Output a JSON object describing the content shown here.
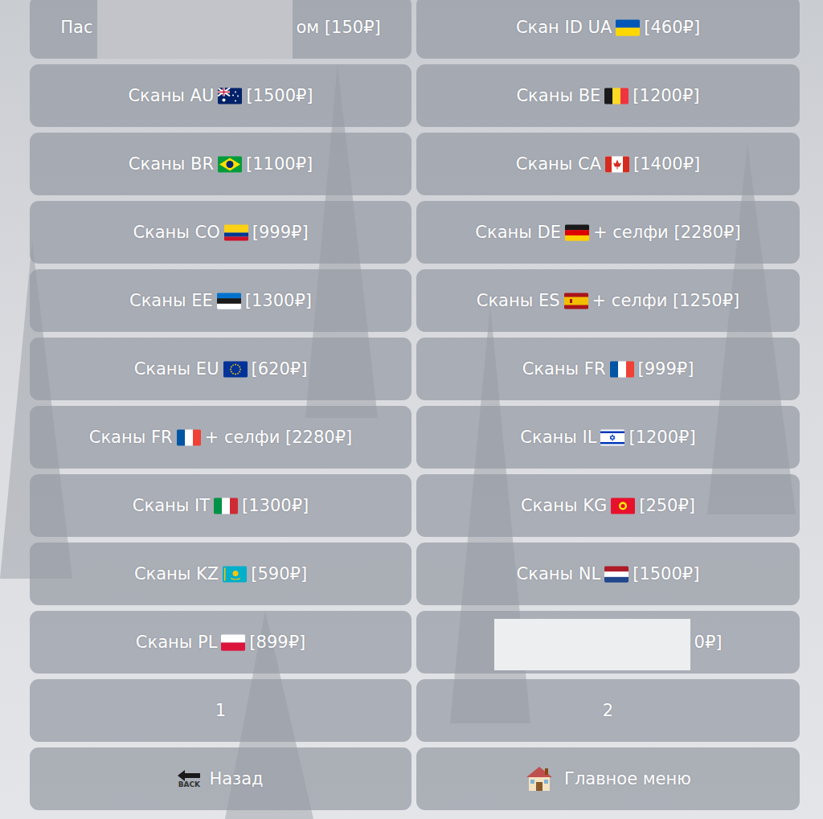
{
  "items": [
    {
      "kind": "redacted-left",
      "prefix": "Пас",
      "suffix": "ом [150₽]"
    },
    {
      "kind": "ua",
      "prefix": "Скан ID UA",
      "suffix": "[460₽]"
    },
    {
      "kind": "au",
      "prefix": "Сканы AU",
      "suffix": "[1500₽]"
    },
    {
      "kind": "be",
      "prefix": "Сканы BE",
      "suffix": "[1200₽]"
    },
    {
      "kind": "br",
      "prefix": "Сканы BR",
      "suffix": "[1100₽]"
    },
    {
      "kind": "ca",
      "prefix": "Сканы CA",
      "suffix": "[1400₽]"
    },
    {
      "kind": "co",
      "prefix": "Сканы CO",
      "suffix": "[999₽]"
    },
    {
      "kind": "de",
      "prefix": "Сканы DE",
      "suffix": "+ селфи [2280₽]"
    },
    {
      "kind": "ee",
      "prefix": "Сканы EE",
      "suffix": "[1300₽]"
    },
    {
      "kind": "es",
      "prefix": "Сканы ES",
      "suffix": "+ селфи [1250₽]"
    },
    {
      "kind": "eu",
      "prefix": "Сканы EU",
      "suffix": "[620₽]"
    },
    {
      "kind": "fr",
      "prefix": "Сканы FR",
      "suffix": "[999₽]"
    },
    {
      "kind": "fr",
      "prefix": "Сканы FR",
      "suffix": "+ селфи [2280₽]"
    },
    {
      "kind": "il",
      "prefix": "Сканы IL",
      "suffix": "[1200₽]"
    },
    {
      "kind": "it",
      "prefix": "Сканы IT",
      "suffix": "[1300₽]"
    },
    {
      "kind": "kg",
      "prefix": "Сканы KG",
      "suffix": "[250₽]"
    },
    {
      "kind": "kz",
      "prefix": "Сканы KZ",
      "suffix": "[590₽]"
    },
    {
      "kind": "nl",
      "prefix": "Сканы NL",
      "suffix": "[1500₽]"
    },
    {
      "kind": "pl",
      "prefix": "Сканы PL",
      "suffix": "[899₽]"
    },
    {
      "kind": "redacted-right",
      "prefix": "",
      "suffix": "0₽]"
    }
  ],
  "pages": [
    {
      "label": "1"
    },
    {
      "label": "2"
    }
  ],
  "nav": {
    "back": {
      "label": "Назад",
      "icon_text": "BACK"
    },
    "home": {
      "label": "Главное меню"
    }
  }
}
